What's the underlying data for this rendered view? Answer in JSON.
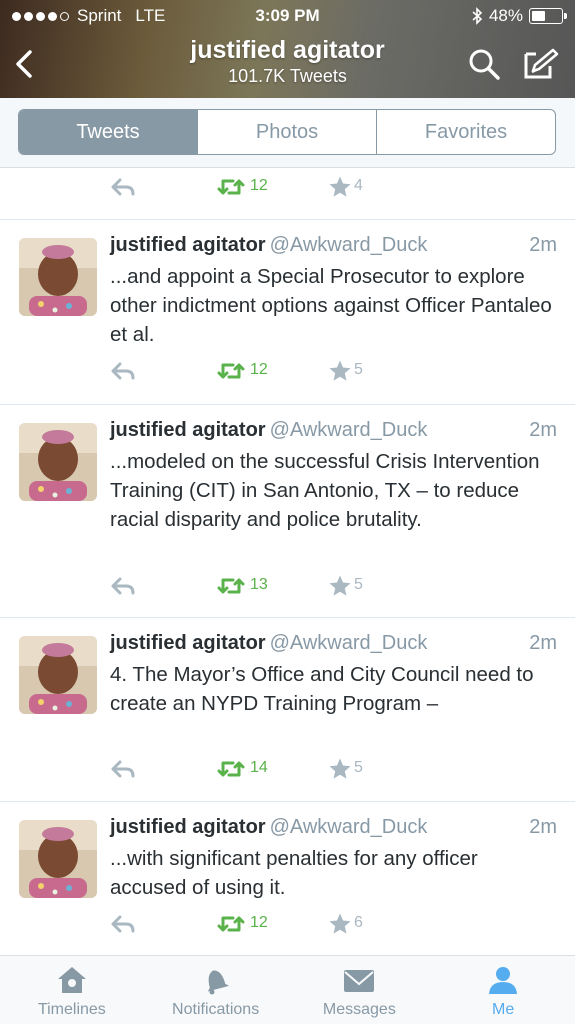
{
  "status_bar": {
    "carrier": "Sprint",
    "network": "LTE",
    "time": "3:09 PM",
    "battery": "48%",
    "battery_level": 0.48,
    "signal_bars": 4
  },
  "header": {
    "title": "justified agitator",
    "subtitle": "101.7K Tweets",
    "icons": [
      "back-icon",
      "search-icon",
      "compose-icon"
    ]
  },
  "tabs": {
    "items": [
      "Tweets",
      "Photos",
      "Favorites"
    ],
    "active": "Tweets"
  },
  "tweets": [
    {
      "name": "",
      "handle": "",
      "time": "",
      "text": "",
      "retweets": "12",
      "favorites": "4"
    },
    {
      "name": "justified agitator",
      "handle": "@Awkward_Duck",
      "time": "2m",
      "text": "...and appoint a Special Prosecutor to explore other indictment options against Officer Pantaleo et al.",
      "retweets": "12",
      "favorites": "5"
    },
    {
      "name": "justified agitator",
      "handle": "@Awkward_Duck",
      "time": "2m",
      "text": "...modeled on the successful Crisis Intervention Training (CIT) in San Antonio, TX – to reduce racial disparity and police brutality.",
      "retweets": "13",
      "favorites": "5"
    },
    {
      "name": "justified agitator",
      "handle": "@Awkward_Duck",
      "time": "2m",
      "text": "4. The Mayor’s Office and City Council need to create an NYPD Training Program –",
      "retweets": "14",
      "favorites": "5"
    },
    {
      "name": "justified agitator",
      "handle": "@Awkward_Duck",
      "time": "2m",
      "text": "...with significant penalties for any officer accused of using it.",
      "retweets": "12",
      "favorites": "6"
    }
  ],
  "tabbar": {
    "items": [
      {
        "label": "Timelines",
        "icon": "home-icon"
      },
      {
        "label": "Notifications",
        "icon": "bell-icon"
      },
      {
        "label": "Messages",
        "icon": "envelope-icon"
      },
      {
        "label": "Me",
        "icon": "person-icon"
      }
    ],
    "active": "Me"
  },
  "colors": {
    "retweet_green": "#5ab24b",
    "muted_gray": "#8899a6",
    "active_blue": "#55acee"
  }
}
